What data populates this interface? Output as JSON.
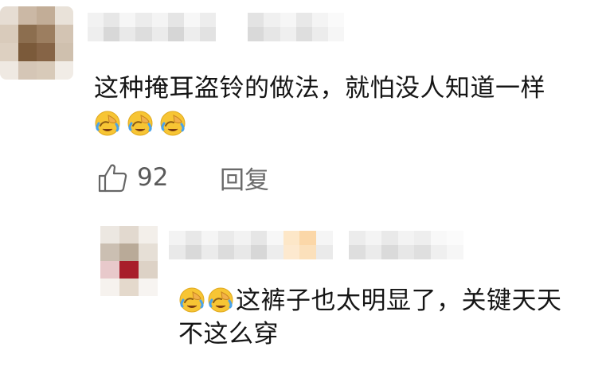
{
  "comment": {
    "text": "这种掩耳盗铃的做法，就怕没人知道一样",
    "emoji_icon": "face-palm-laughing-icon",
    "emoji_count": 3,
    "like_icon": "thumbs-up-icon",
    "likes": "92",
    "reply_label": "回复"
  },
  "reply": {
    "emoji_icon": "face-palm-laughing-icon",
    "emoji_count": 2,
    "text_line1": "这裤子也太明显了，关键天天",
    "text_line2": "不这么穿"
  },
  "colors": {
    "emoji_face": "#f7c534",
    "emoji_hand": "#f2b04a",
    "tear": "#4aa3ea"
  }
}
